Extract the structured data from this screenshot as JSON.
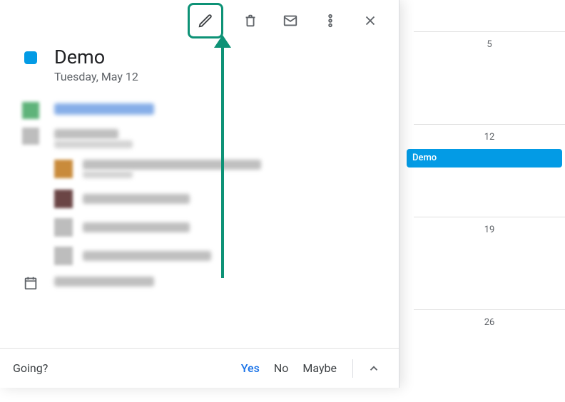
{
  "calendar": {
    "dates": [
      "5",
      "12",
      "19",
      "26"
    ],
    "event_label": "Demo"
  },
  "event": {
    "title": "Demo",
    "date": "Tuesday, May 12"
  },
  "rsvp": {
    "prompt": "Going?",
    "yes": "Yes",
    "no": "No",
    "maybe": "Maybe",
    "selected": "yes"
  },
  "colors": {
    "event": "#039be5",
    "highlight": "#0d9276",
    "link": "#1a73e8"
  }
}
